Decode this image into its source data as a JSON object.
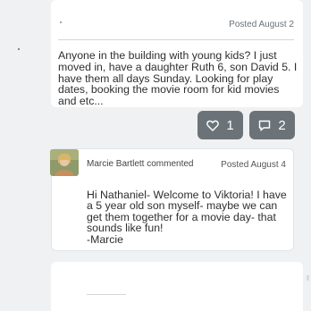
{
  "post": {
    "date": "Posted August 2",
    "body": "Anyone in the building with young kids? I just moved in, have a daughter Ruth 6, son David 5. I have them all days Sunday. Looking for play dates, booking the movie room for kid movies and etc..."
  },
  "actions": {
    "likes_count": "1",
    "comments_count": "2",
    "like_icon": "heart-icon",
    "comment_icon": "speech-bubble-icon"
  },
  "comment": {
    "author_line": "Marcie Bartlett commented",
    "date": "Posted August 4",
    "body": "Hi Nathaniel- Welcome to Viktoria! I have a 5 year old son myself- maybe we can get them together for a movie day- that sounds like fun!\n-Marcie"
  },
  "colors": {
    "background": "#f0f1f2",
    "card": "#ffffff",
    "button": "#6c7378"
  }
}
